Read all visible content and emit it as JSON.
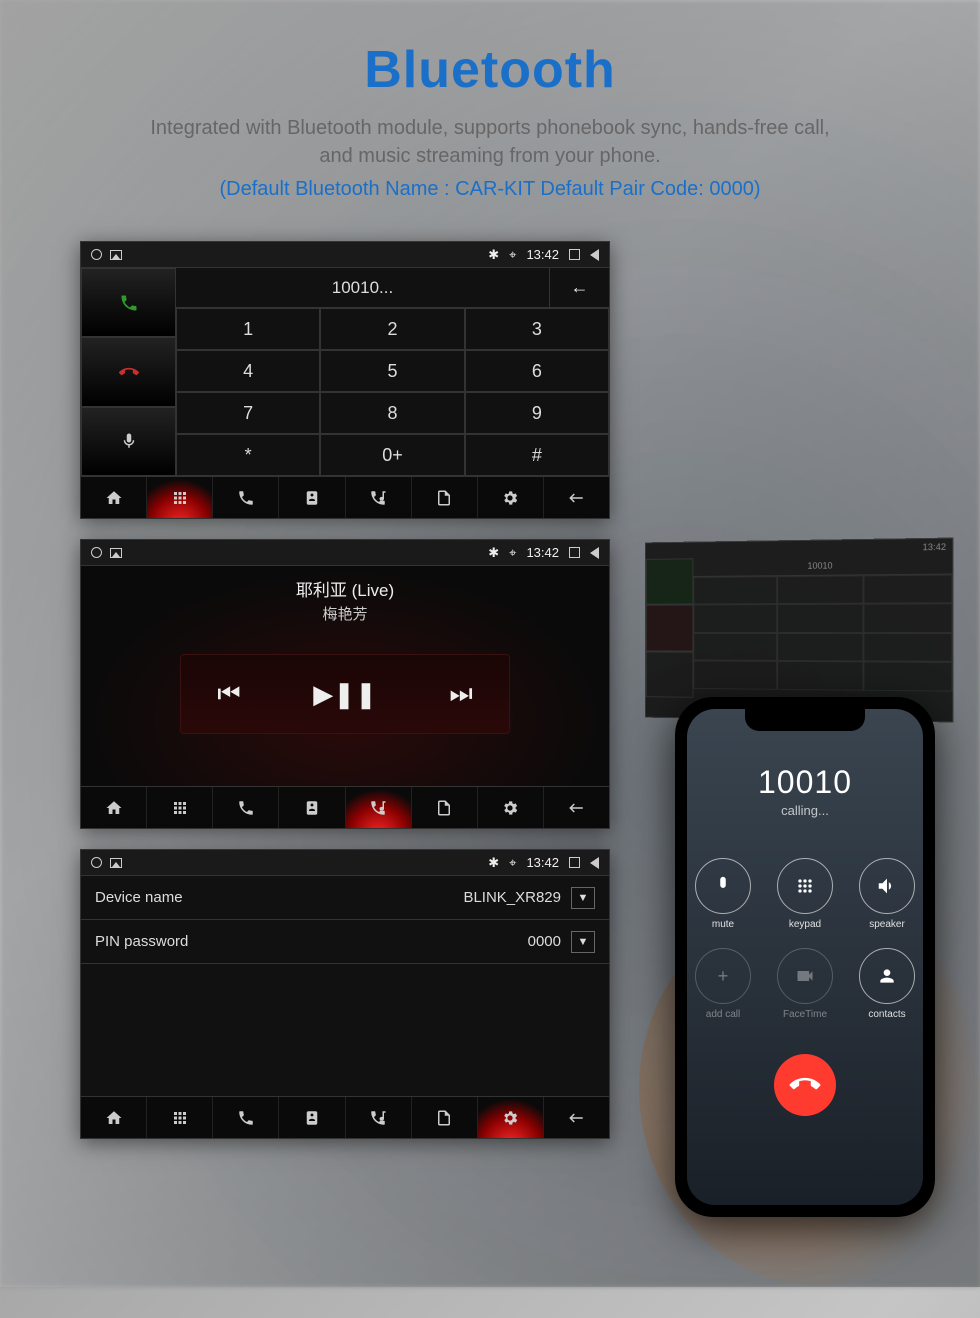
{
  "hero": {
    "title": "Bluetooth",
    "subtitle_l1": "Integrated with Bluetooth module, supports phonebook sync, hands-free call,",
    "subtitle_l2": "and music streaming from your phone.",
    "note": "(Default Bluetooth Name : CAR-KIT   Default Pair Code: 0000)"
  },
  "status": {
    "time": "13:42"
  },
  "dialer": {
    "display": "10010...",
    "backspace": "←",
    "keys": [
      "1",
      "2",
      "3",
      "4",
      "5",
      "6",
      "7",
      "8",
      "9",
      "*",
      "0+",
      "#"
    ]
  },
  "music": {
    "title": "耶利亚 (Live)",
    "artist": "梅艳芳",
    "prev": "⏮",
    "play": "▶❚❚",
    "next": "⏭"
  },
  "settings": {
    "device_label": "Device name",
    "device_value": "BLINK_XR829",
    "pin_label": "PIN password",
    "pin_value": "0000"
  },
  "phone": {
    "number": "10010",
    "status": "calling...",
    "btns": [
      {
        "label": "mute",
        "dim": false
      },
      {
        "label": "keypad",
        "dim": false
      },
      {
        "label": "speaker",
        "dim": false
      },
      {
        "label": "add call",
        "dim": true
      },
      {
        "label": "FaceTime",
        "dim": true
      },
      {
        "label": "contacts",
        "dim": false
      }
    ]
  },
  "dash": {
    "display": "10010",
    "time": "13:42"
  }
}
